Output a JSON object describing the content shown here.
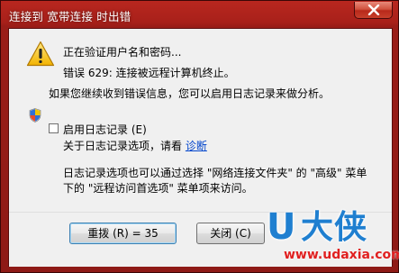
{
  "window": {
    "title": "连接到 宽带连接 时出错"
  },
  "message": {
    "status_line": "正在验证用户名和密码...",
    "error_line": "错误 629: 连接被远程计算机终止。",
    "advice_line": "如果您继续收到错误信息，您可以启用日志记录来做分析。"
  },
  "logging": {
    "checkbox_label": "启用日志记录 (E)",
    "checked": false,
    "info_prefix": "关于日志记录选项，请看",
    "diagnose_link": "诊断",
    "note_line_1": "日志记录选项也可以通过选择 \"网络连接文件夹\" 的 \"高级\" 菜单",
    "note_line_2": "下的 \"远程访问首选项\" 菜单项来访问。"
  },
  "buttons": {
    "redial_label": "重拨 (R) = 35",
    "close_label": "关闭 (C)"
  },
  "watermark": {
    "logo_letter": "U",
    "logo_text": "大侠",
    "url": "www.udaxia.com"
  },
  "colors": {
    "title_bar": "#a8201a",
    "link": "#0044cc",
    "watermark_blue": "#1f7fd0",
    "watermark_red": "#e02020"
  },
  "icons": {
    "warning": "warning-icon",
    "shield": "shield-icon",
    "close": "close-icon"
  }
}
